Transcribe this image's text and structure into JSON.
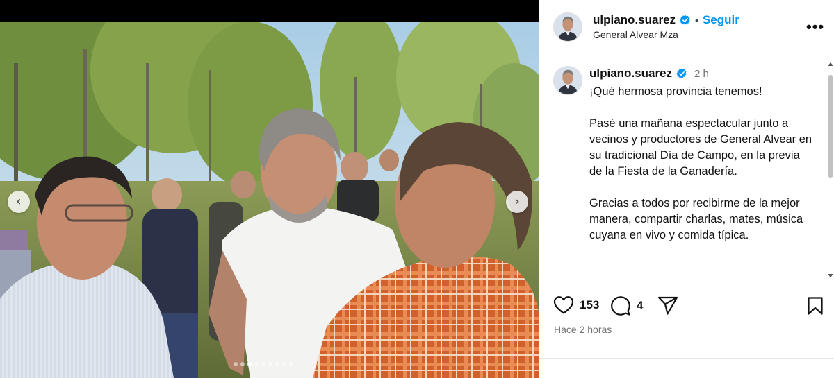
{
  "post": {
    "username": "ulpiano.suarez",
    "follow_label": "Seguir",
    "separator": "•",
    "location": "General Alvear Mza",
    "more_label": "•••",
    "time_short": "2 h",
    "caption": "¡Qué hermosa provincia tenemos!\n\nPasé una mañana espectacular junto a vecinos y productores de General Alvear en su tradicional Día de Campo, en la previa de la Fiesta de la Ganadería.\n\nGracias a todos por recibirme de la mejor manera, compartir charlas, mates, música cuyana en vivo y comida típica.",
    "likes": "153",
    "comments": "4",
    "posted_ago": "Hace 2 horas"
  },
  "carousel": {
    "prev_glyph": "‹",
    "next_glyph": "›",
    "slide_count": 9,
    "active_index": 2
  },
  "icons": {
    "verified": "verified-badge-icon",
    "like": "heart-icon",
    "comment": "comment-bubble-icon",
    "share": "paper-plane-icon",
    "save": "bookmark-icon",
    "more": "more-options-icon"
  },
  "colors": {
    "accent": "#0095f6",
    "verified": "#0095f6",
    "text": "#111111",
    "muted": "#737373"
  }
}
